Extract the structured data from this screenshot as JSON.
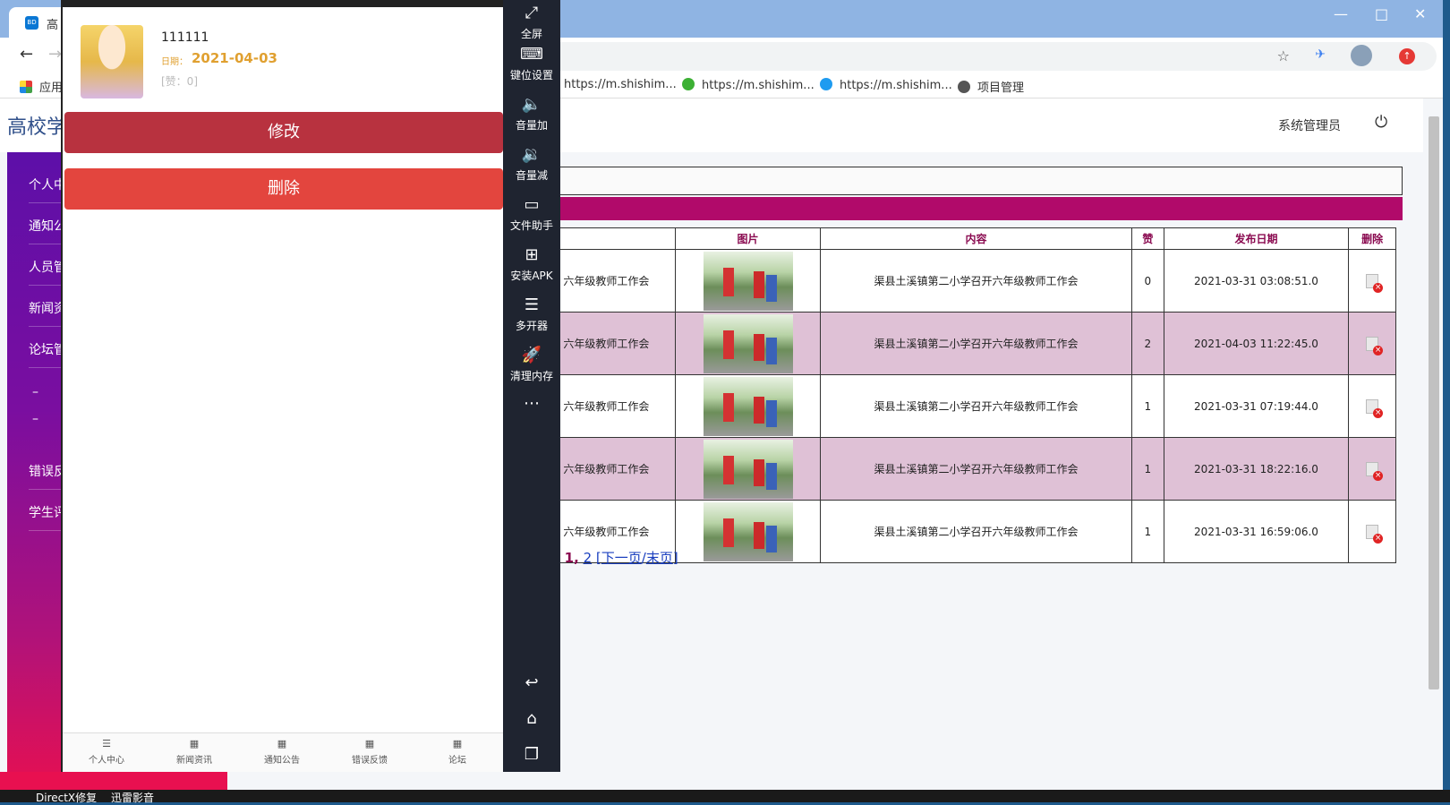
{
  "browser": {
    "tab_title": "高",
    "favicon_text": "BD",
    "omnibox_star": "☆",
    "bookmarks": {
      "apps": "应用",
      "bm1": "https://m.shishim...",
      "bm2": "https://m.shishim...",
      "bm3": "https://m.shishim...",
      "bm4": "项目管理"
    }
  },
  "page": {
    "site_title": "高校学",
    "admin_name": "系统管理员",
    "sidebar": [
      "个人中",
      "通知公",
      "人员管",
      "新闻资",
      "论坛管",
      "错误反",
      "学生评"
    ],
    "table": {
      "headers": [
        "",
        "图片",
        "内容",
        "赞",
        "发布日期",
        "删除"
      ],
      "rows": [
        {
          "title": "六年级教师工作会",
          "content": "渠县土溪镇第二小学召开六年级教师工作会",
          "likes": "0",
          "date": "2021-03-31 03:08:51.0"
        },
        {
          "title": "六年级教师工作会",
          "content": "渠县土溪镇第二小学召开六年级教师工作会",
          "likes": "2",
          "date": "2021-04-03 11:22:45.0"
        },
        {
          "title": "六年级教师工作会",
          "content": "渠县土溪镇第二小学召开六年级教师工作会",
          "likes": "1",
          "date": "2021-03-31 07:19:44.0"
        },
        {
          "title": "六年级教师工作会",
          "content": "渠县土溪镇第二小学召开六年级教师工作会",
          "likes": "1",
          "date": "2021-03-31 18:22:16.0"
        },
        {
          "title": "六年级教师工作会",
          "content": "渠县土溪镇第二小学召开六年级教师工作会",
          "likes": "1",
          "date": "2021-03-31 16:59:06.0"
        }
      ]
    },
    "pager": {
      "prefix": "页]",
      "current": "1",
      "sep": ",",
      "page2": "2",
      "next": "下一页",
      "slash": "/",
      "last": "末页",
      "open": "[",
      "close": "]"
    }
  },
  "emulator": {
    "name": "111111",
    "date_label": "日期：",
    "date": "2021-04-03",
    "likes": "[赞：0]",
    "edit_label": "修改",
    "delete_label": "删除",
    "nav": [
      "个人中心",
      "新闻资讯",
      "通知公告",
      "错误反馈",
      "论坛"
    ],
    "tools": [
      "全屏",
      "键位设置",
      "音量加",
      "音量减",
      "文件助手",
      "安装APK",
      "多开器",
      "清理内存"
    ]
  },
  "taskbar": [
    "DirectX修复",
    "迅雷影音"
  ]
}
